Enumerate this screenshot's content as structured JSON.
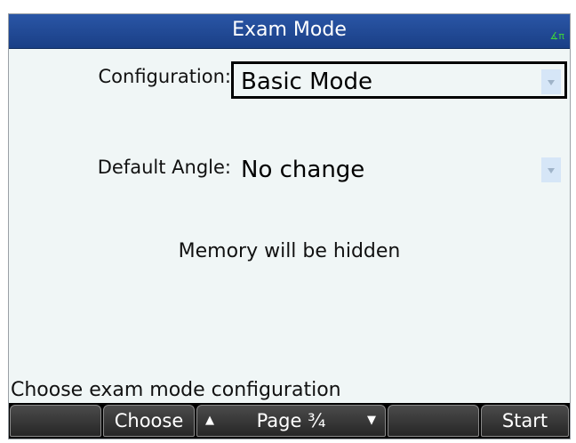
{
  "title_bar": {
    "title": "Exam Mode",
    "angle_indicator": "∡π",
    "angle_indicator_color": "#3cd13c"
  },
  "form": {
    "configuration": {
      "label": "Configuration:",
      "value": "Basic Mode"
    },
    "default_angle": {
      "label": "Default Angle:",
      "value": "No change"
    }
  },
  "info_text": "Memory will be hidden",
  "help_text": "Choose exam mode configuration",
  "menu": {
    "key1": "",
    "key2": "Choose",
    "key3_label": "Page ³⁄₄",
    "key3_up": "▲",
    "key3_down": "▼",
    "key4": "",
    "key5": "",
    "key6": "Start"
  },
  "colors": {
    "title_bar": "#1f4b95",
    "background": "#f0f6f6",
    "dropdown_arrow_bg": "#d6e6f7",
    "menubar": "#000000"
  }
}
